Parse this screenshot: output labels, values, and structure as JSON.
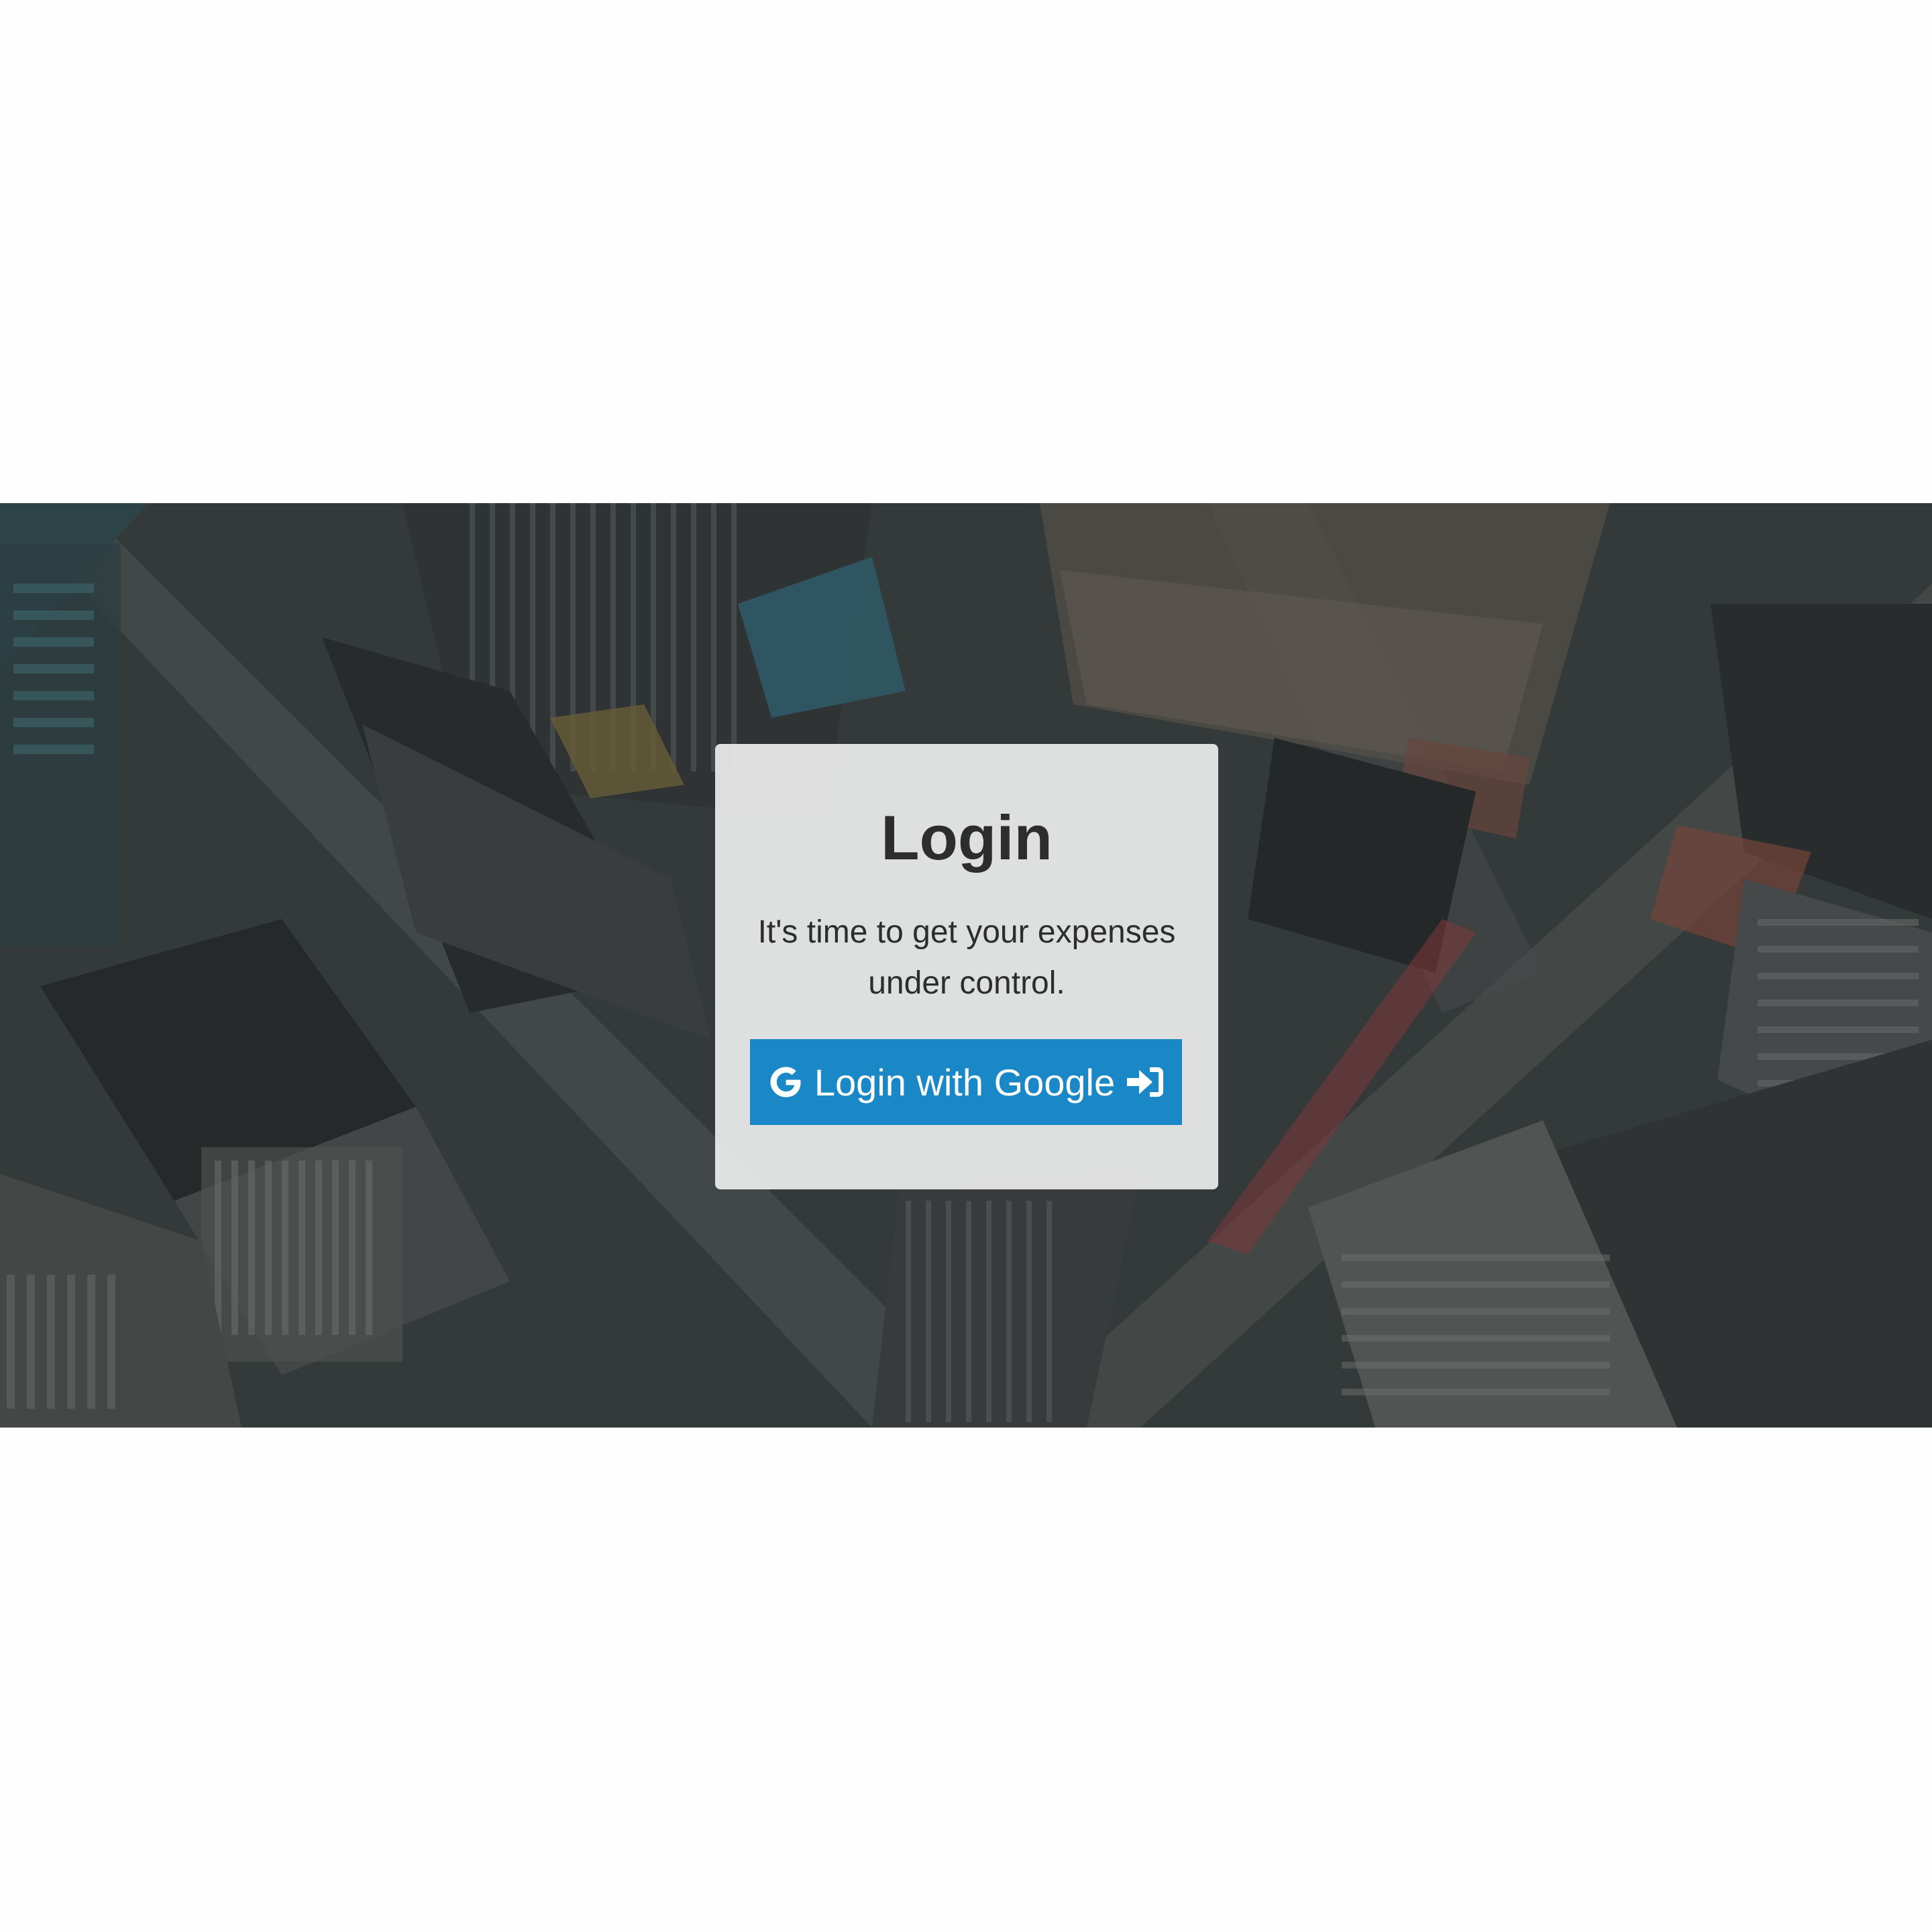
{
  "login_card": {
    "title": "Login",
    "tagline": "It's time to get your expenses under control.",
    "button": {
      "label": "Login with Google",
      "leading_icon": "google-icon",
      "trailing_icon": "sign-in-icon"
    }
  },
  "background": {
    "image": "aerial-city-photo"
  },
  "colors": {
    "button_bg": "#1a87c6",
    "button_text": "#ffffff",
    "card_bg": "#ececec",
    "text": "#2d2d2d"
  }
}
